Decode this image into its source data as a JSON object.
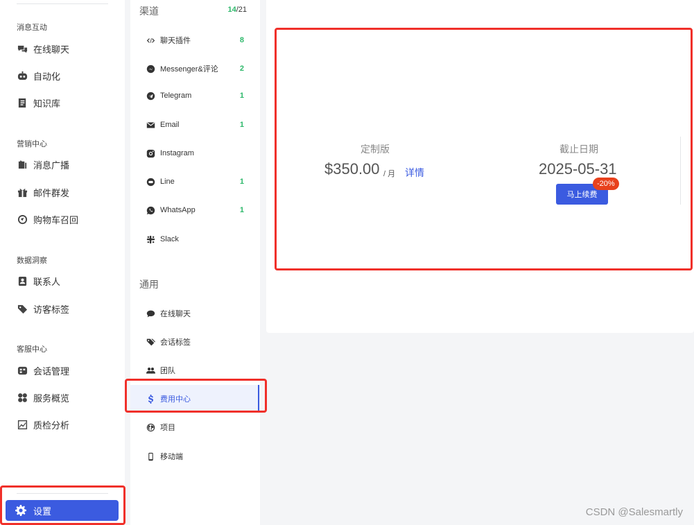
{
  "sidebar": {
    "sections": [
      {
        "title": "消息互动",
        "items": [
          {
            "label": "在线聊天",
            "icon": "chat-bubbles-icon"
          },
          {
            "label": "自动化",
            "icon": "robot-icon"
          },
          {
            "label": "知识库",
            "icon": "book-icon"
          }
        ]
      },
      {
        "title": "营销中心",
        "items": [
          {
            "label": "消息广播",
            "icon": "broadcast-icon"
          },
          {
            "label": "邮件群发",
            "icon": "gift-icon"
          },
          {
            "label": "购物车召回",
            "icon": "cart-recall-icon"
          }
        ]
      },
      {
        "title": "数据洞察",
        "items": [
          {
            "label": "联系人",
            "icon": "contact-icon"
          },
          {
            "label": "访客标签",
            "icon": "tag-icon"
          }
        ]
      },
      {
        "title": "客服中心",
        "items": [
          {
            "label": "会话管理",
            "icon": "session-icon"
          },
          {
            "label": "服务概览",
            "icon": "overview-icon"
          },
          {
            "label": "质检分析",
            "icon": "chart-icon"
          }
        ]
      }
    ],
    "settings_label": "设置"
  },
  "channels": {
    "title": "渠道",
    "count_active": "14",
    "count_total": "/21",
    "items": [
      {
        "label": "聊天插件",
        "count": "8"
      },
      {
        "label": "Messenger&评论",
        "count": "2"
      },
      {
        "label": "Telegram",
        "count": "1"
      },
      {
        "label": "Email",
        "count": "1"
      },
      {
        "label": "Instagram",
        "count": ""
      },
      {
        "label": "Line",
        "count": "1"
      },
      {
        "label": "WhatsApp",
        "count": "1"
      },
      {
        "label": "Slack",
        "count": ""
      }
    ]
  },
  "general": {
    "title": "通用",
    "items": [
      {
        "label": "在线聊天"
      },
      {
        "label": "会话标签"
      },
      {
        "label": "团队"
      },
      {
        "label": "费用中心"
      },
      {
        "label": "项目"
      },
      {
        "label": "移动端"
      }
    ]
  },
  "billing": {
    "plan_label": "定制版",
    "price": "$350.00",
    "per": "/ 月",
    "details_link": "详情",
    "deadline_label": "截止日期",
    "deadline": "2025-05-31",
    "renew_button": "马上续费",
    "discount_badge": "-20%"
  },
  "watermark": "CSDN @Salesmartly",
  "colors": {
    "primary": "#3b5be0",
    "success": "#2eb86b",
    "highlight_red": "#f0302a",
    "badge": "#e8411d"
  }
}
